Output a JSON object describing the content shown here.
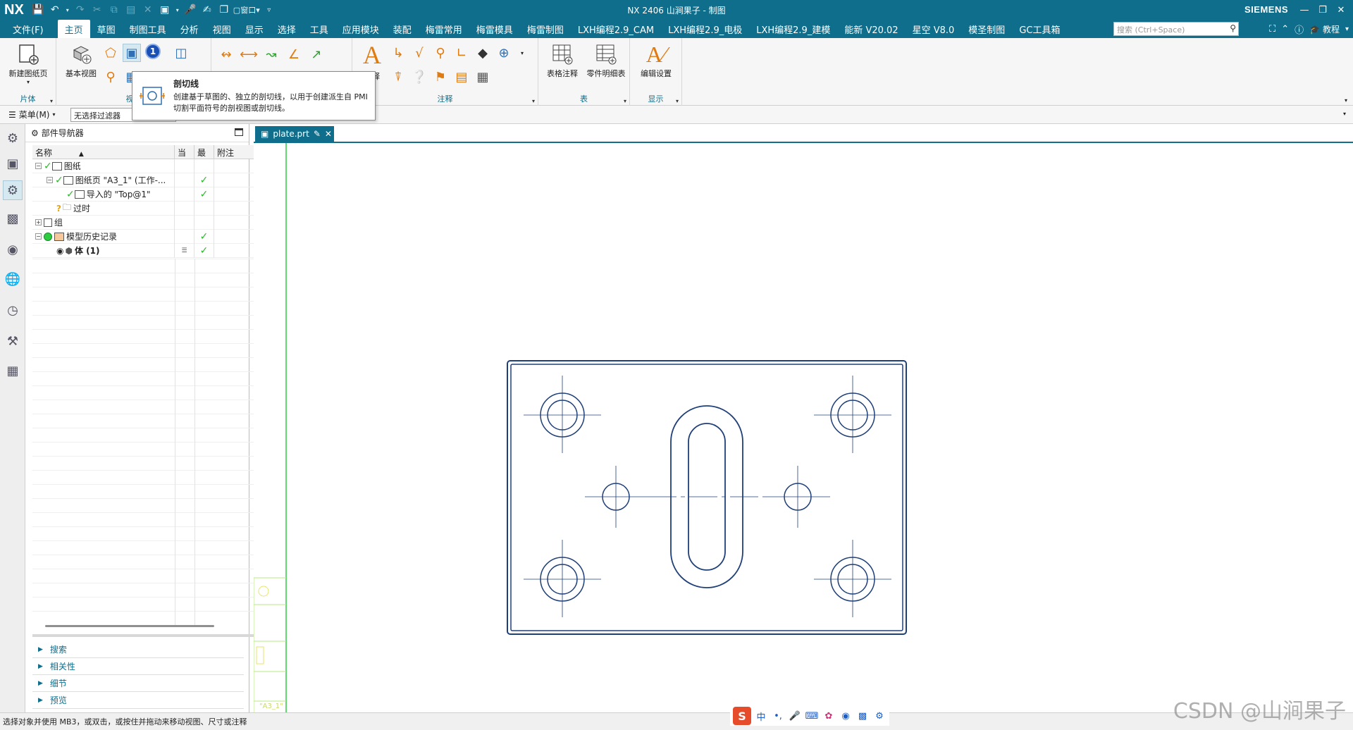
{
  "titlebar": {
    "logo": "NX",
    "title": "NX 2406 山涧果子 - 制图",
    "brand": "SIEMENS",
    "window_menu": "窗口"
  },
  "menu": {
    "file": "文件(F)",
    "tabs": [
      "主页",
      "草图",
      "制图工具",
      "分析",
      "视图",
      "显示",
      "选择",
      "工具",
      "应用模块",
      "装配",
      "梅雷常用",
      "梅雷模具",
      "梅雷制图",
      "LXH编程2.9_CAM",
      "LXH编程2.9_电极",
      "LXH编程2.9_建模",
      "能新 V20.02",
      "星空 V8.0",
      "模圣制图",
      "GC工具箱"
    ],
    "active_tab": "主页",
    "search_placeholder": "搜索 (Ctrl+Space)",
    "tutorial": "教程"
  },
  "ribbon": {
    "new_sheet_label": "新建图纸页",
    "group_sheet": "片体",
    "base_view_label": "基本视图",
    "group_view": "视图",
    "group_annotation": "注释",
    "table_note_label": "表格注释",
    "parts_list_label": "零件明细表",
    "group_table": "表",
    "edit_settings_label": "编辑设置",
    "group_display": "显示",
    "annotation_stub": "释",
    "badge_number": "1"
  },
  "tooltip": {
    "title": "剖切线",
    "description": "创建基于草图的、独立的剖切线，以用于创建派生自 PMI 切割平面符号的剖视图或剖切线。"
  },
  "selbar": {
    "menu_label": "菜单(M)",
    "filter_value": "无选择过滤器"
  },
  "navigator": {
    "title": "部件导航器",
    "columns": {
      "name": "名称",
      "current": "当",
      "latest": "最",
      "note": "附注"
    },
    "rows": [
      {
        "label": "图纸"
      },
      {
        "label": "图纸页 \"A3_1\" (工作-..."
      },
      {
        "label": "导入的 \"Top@1\""
      },
      {
        "label": "过时"
      },
      {
        "label": "组"
      },
      {
        "label": "模型历史记录"
      },
      {
        "label": "体 (1)"
      }
    ],
    "sections": [
      "搜索",
      "相关性",
      "细节",
      "预览"
    ]
  },
  "document": {
    "tab_label": "plate.prt",
    "sheet_name_fragment": "\"A3_1\""
  },
  "statusbar": {
    "message": "选择对象并使用 MB3，或双击，或按住并拖动来移动视图、尺寸或注释"
  },
  "ime": {
    "logo": "S",
    "lang": "中"
  },
  "watermark": "CSDN @山涧果子",
  "colors": {
    "accent": "#0e6e8c",
    "drawing_line": "#1f3f78",
    "check": "#2ab82a",
    "border_yellow": "#b8e986",
    "sheet_green": "#2ecc40"
  }
}
